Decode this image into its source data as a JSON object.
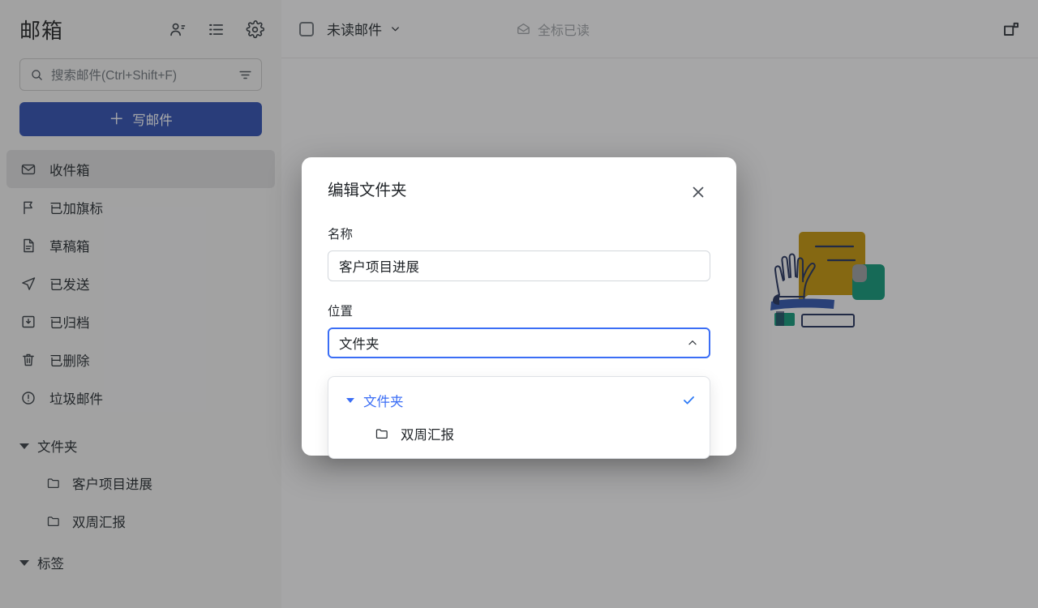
{
  "sidebar": {
    "title": "邮箱",
    "header_icons": [
      {
        "name": "contacts-icon",
        "label": "contacts-icon"
      },
      {
        "name": "list-icon",
        "label": "list-icon"
      },
      {
        "name": "settings-gear-icon",
        "label": "gear-icon"
      }
    ],
    "search": {
      "placeholder": "搜索邮件(Ctrl+Shift+F)",
      "icon": "search-icon",
      "filter_icon": "filter-icon"
    },
    "compose": {
      "label": "写邮件",
      "plus": "＋"
    },
    "nav": [
      {
        "label": "收件箱",
        "icon": "inbox-icon",
        "active": true
      },
      {
        "label": "已加旗标",
        "icon": "flag-icon",
        "active": false
      },
      {
        "label": "草稿箱",
        "icon": "draft-icon",
        "active": false
      },
      {
        "label": "已发送",
        "icon": "send-icon",
        "active": false
      },
      {
        "label": "已归档",
        "icon": "archive-icon",
        "active": false
      },
      {
        "label": "已删除",
        "icon": "trash-icon",
        "active": false
      },
      {
        "label": "垃圾邮件",
        "icon": "junk-icon",
        "active": false
      }
    ],
    "folders_group": {
      "label": "文件夹",
      "items": [
        {
          "label": "客户项目进展",
          "icon": "folder-icon"
        },
        {
          "label": "双周汇报",
          "icon": "folder-icon"
        }
      ]
    },
    "tags_group": {
      "label": "标签",
      "items": []
    }
  },
  "toolbar": {
    "select_all_checkbox": "select-all-checkbox",
    "filter_label": "未读邮件",
    "filter_caret": "chevron-down-icon",
    "mark_all_read_label": "全标已读",
    "mark_all_read_icon": "envelope-open-icon",
    "split_view_icon": "split-view-icon"
  },
  "modal": {
    "title": "编辑文件夹",
    "close_icon": "close-icon",
    "name_field": {
      "label": "名称",
      "value": "客户项目进展",
      "placeholder": ""
    },
    "location_field": {
      "label": "位置",
      "value": "文件夹",
      "caret_icon": "chevron-up-icon",
      "dropdown": {
        "open": true,
        "options": [
          {
            "label": "文件夹",
            "level": 0,
            "selected": true,
            "expanded": true,
            "check_icon": "check-icon"
          },
          {
            "label": "双周汇报",
            "level": 1,
            "selected": false,
            "icon": "folder-icon"
          }
        ]
      }
    }
  },
  "colors": {
    "accent_blue": "#3b6ef5",
    "compose_blue": "#2b4aad",
    "sidebar_bg": "#f3f2f1",
    "main_bg": "#faf9f8",
    "active_item_bg": "#dedddc",
    "illustration_gold": "#c49200",
    "illustration_teal": "#0b9474",
    "illustration_blue": "#2a4fa8",
    "overlay": "rgba(40,42,46,0.40)"
  }
}
